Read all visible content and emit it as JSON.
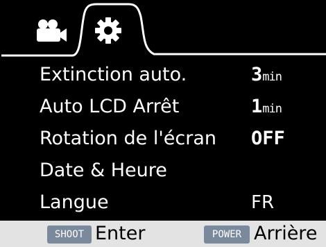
{
  "tabs": [
    {
      "icon": "video-camera-icon",
      "active": false
    },
    {
      "icon": "gear-icon",
      "active": true
    }
  ],
  "menu": {
    "items": [
      {
        "label": "Extinction auto.",
        "value": "3",
        "unit": "min"
      },
      {
        "label": "Auto LCD Arrêt",
        "value": "1",
        "unit": "min"
      },
      {
        "label": "Rotation de l'écran",
        "value": "OFF",
        "unit": ""
      },
      {
        "label": "Date & Heure",
        "value": "",
        "unit": ""
      },
      {
        "label": "Langue",
        "value": "FR",
        "unit": ""
      }
    ]
  },
  "footer": {
    "shoot_key": "SHOOT",
    "shoot_action": "Enter",
    "power_key": "POWER",
    "power_action": "Arrière"
  },
  "colors": {
    "background": "#000000",
    "footer_background": "#e3e3e3",
    "key_badge": "#7a8a9c",
    "text": "#ffffff"
  }
}
